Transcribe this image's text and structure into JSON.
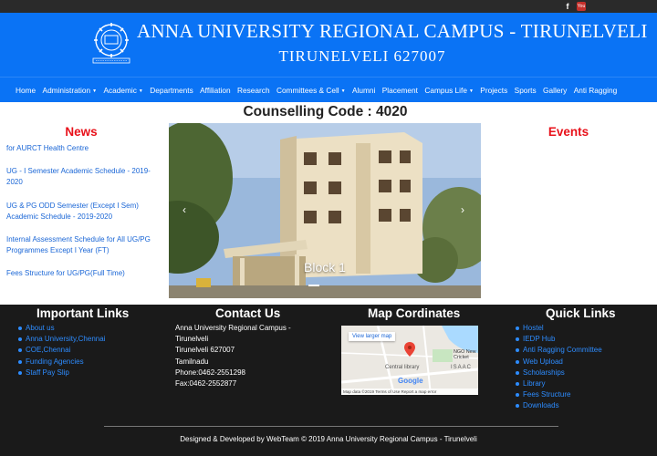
{
  "topbar": {
    "facebook_icon": "f",
    "youtube_icon": "You Tube"
  },
  "header": {
    "title": "ANNA UNIVERSITY REGIONAL CAMPUS - TIRUNELVELI",
    "subtitle": "TIRUNELVELI 627007"
  },
  "nav": {
    "items": [
      {
        "label": "Home"
      },
      {
        "label": "Administration",
        "dropdown": true
      },
      {
        "label": "Academic",
        "dropdown": true
      },
      {
        "label": "Departments"
      },
      {
        "label": "Affiliation"
      },
      {
        "label": "Research"
      },
      {
        "label": "Committees & Cell",
        "dropdown": true
      },
      {
        "label": "Alumni"
      },
      {
        "label": "Placement"
      },
      {
        "label": "Campus Life",
        "dropdown": true
      },
      {
        "label": "Projects"
      },
      {
        "label": "Sports"
      },
      {
        "label": "Gallery"
      },
      {
        "label": "Anti Ragging"
      }
    ]
  },
  "main": {
    "counselling": "Counselling Code : 4020",
    "news_title": "News",
    "events_title": "Events",
    "news": [
      "for AURCT Health Centre",
      "UG - I Semester Academic Schedule - 2019-2020",
      "UG & PG ODD Semester (Except I Sem) Academic Schedule - 2019-2020",
      "Internal Assessment Schedule for All UG/PG Programmes Except I Year (FT)",
      "Fees Structure for UG/PG(Full Time)"
    ],
    "slider": {
      "caption": "Block 1",
      "prev": "‹",
      "next": "›"
    }
  },
  "footer": {
    "important_title": "Important Links",
    "important_links": [
      "About us",
      "Anna University,Chennai",
      "COE,Chennai",
      "Funding Agencies",
      "Staff Pay Slip"
    ],
    "contact_title": "Contact Us",
    "contact_lines": [
      "Anna University Regional Campus -",
      "Tirunelveli",
      "Tirunelveli 627007",
      "Tamilnadu",
      "Phone:0462-2551298",
      "Fax:0462-2552877"
    ],
    "map_title": "Map Cordinates",
    "map": {
      "view_larger": "View larger map",
      "label_library": "Central library",
      "label_ngo": "NGO New Cricket",
      "label_isaac": "ISAAC",
      "google": "Google",
      "attribution": "Map data ©2019   Terms of Use   Report a map error"
    },
    "quick_title": "Quick Links",
    "quick_links": [
      "Hostel",
      "IEDP Hub",
      "Anti Ragging Committee",
      "Web Upload",
      "Scholarships",
      "Library",
      "Fees Structure",
      "Downloads"
    ],
    "credit": "Designed & Developed by WebTeam © 2019 Anna University Regional Campus - Tirunelveli"
  },
  "colors": {
    "brand_blue": "#0a73f5",
    "news_red": "#e8111a",
    "link_blue": "#1a66d6",
    "footer_bg": "#1a1a1a"
  }
}
